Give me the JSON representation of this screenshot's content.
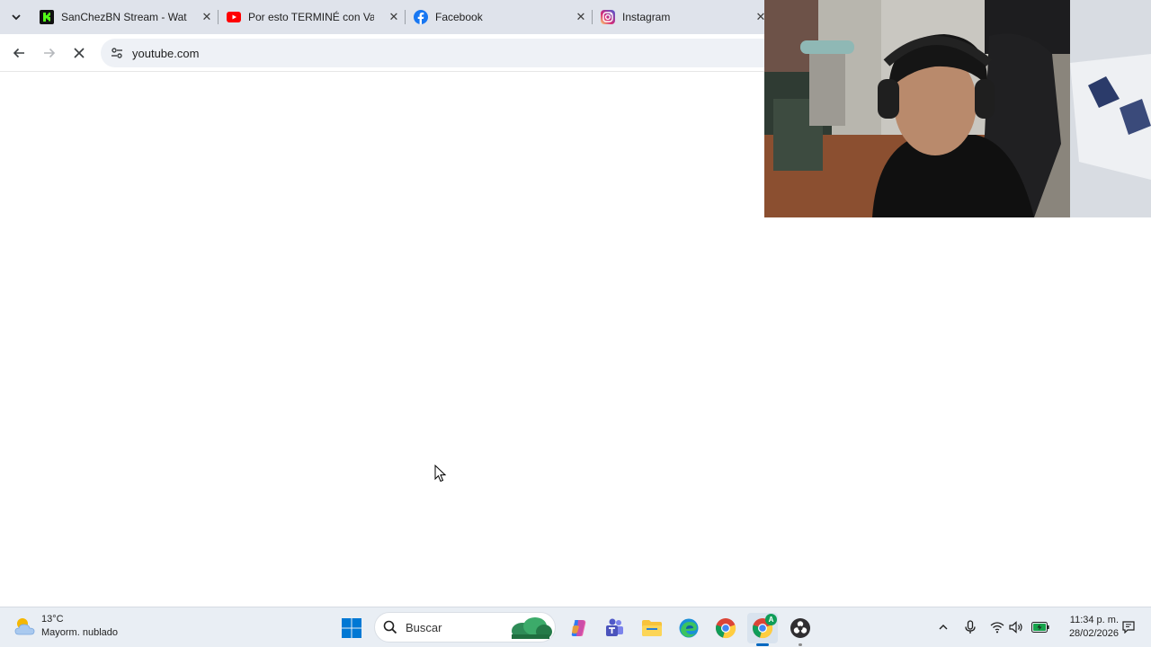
{
  "browser": {
    "tabs": [
      {
        "title": "SanChezBN Stream - Watch",
        "icon": "kick-icon"
      },
      {
        "title": "Por esto TERMINÉ con Valeri",
        "icon": "youtube-icon"
      },
      {
        "title": "Facebook",
        "icon": "facebook-icon"
      },
      {
        "title": "Instagram",
        "icon": "instagram-icon"
      }
    ],
    "close_glyph": "✕",
    "url": "youtube.com",
    "loading": true
  },
  "taskbar": {
    "weather": {
      "temp": "13°C",
      "condition": "Mayorm. nublado"
    },
    "search_placeholder": "Buscar",
    "pinned": [
      "windows-start-icon",
      "copilot-icon",
      "teams-icon",
      "file-explorer-icon",
      "edge-icon",
      "chrome-icon",
      "chrome-profile-icon",
      "obs-icon"
    ],
    "clock": {
      "time": "11:34 p. m.",
      "date": "28/02/2026"
    },
    "chrome_profile_badge": "A"
  },
  "colors": {
    "tabstrip": "#dfe3eb",
    "omnibox": "#eef1f6",
    "taskbar": "#e9eef4",
    "accent": "#0067c0"
  }
}
